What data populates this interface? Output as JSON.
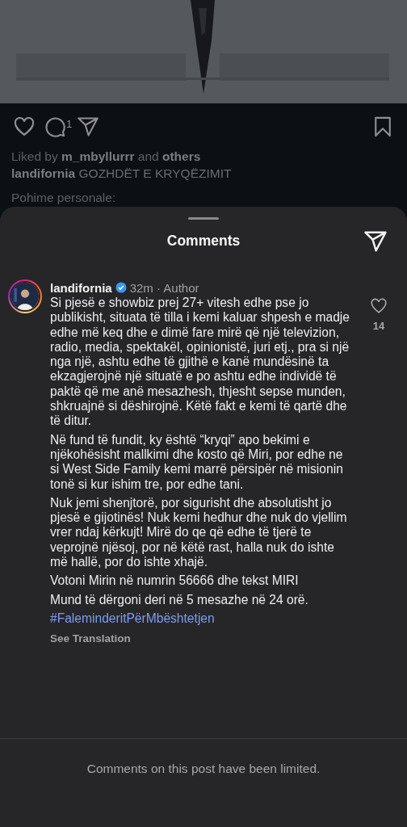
{
  "post": {
    "comment_count": "1",
    "saved": false,
    "liked": false,
    "liked_by": "Liked by **m_mbyllurrr** and **others**",
    "caption": "**landifornia** GOZHDËT E KRYQËZIMIT",
    "caption_more": "Pohime personale:"
  },
  "comments_sheet": {
    "title": "Comments",
    "comment": {
      "username": "landifornia",
      "verified": true,
      "meta": "32m · Author",
      "paragraphs": [
        "Si pjesë e showbiz  prej 27+ vitesh edhe pse jo publikisht, situata të tilla i kemi kaluar shpesh e madje edhe më keq dhe e dimë fare mirë që një televizion, radio, media, spektakël, opinionistë, juri etj., pra si një nga një, ashtu edhe të gjithë e kanë mundësinë ta ekzagjerojnë një situatë e po ashtu edhe individë të paktë që me anë mesazhesh, thjesht sepse munden, shkruajnë si dëshirojnë. Këtë fakt e kemi të qartë dhe të ditur.",
        "Në fund të fundit, ky është “kryqi” apo bekimi e njëkohësisht mallkimi dhe kosto që Miri, por edhe ne si West Side Family kemi marrë përsipër në misionin tonë si kur ishim tre, por edhe tani.",
        "Nuk jemi shenjtorë, por sigurisht dhe absolutisht jo pjesë e gijotinës! Nuk kemi hedhur dhe nuk do vjellim vrer ndaj kërkujt! Mirë do qe që edhe të tjerë te veprojnë njësoj, por në këtë rast, halla nuk do ishte më hallë, por do ishte xhajë.",
        "Votoni Mirin në numrin 56666 dhe tekst MIRI",
        "Mund të dërgoni deri në 5 mesazhe në 24 orë."
      ],
      "hashtag": "#FaleminderitPërMbështetjen",
      "see_translation": "See Translation",
      "like_count": "14",
      "liked": false
    },
    "footer": "Comments on this post have been limited."
  }
}
